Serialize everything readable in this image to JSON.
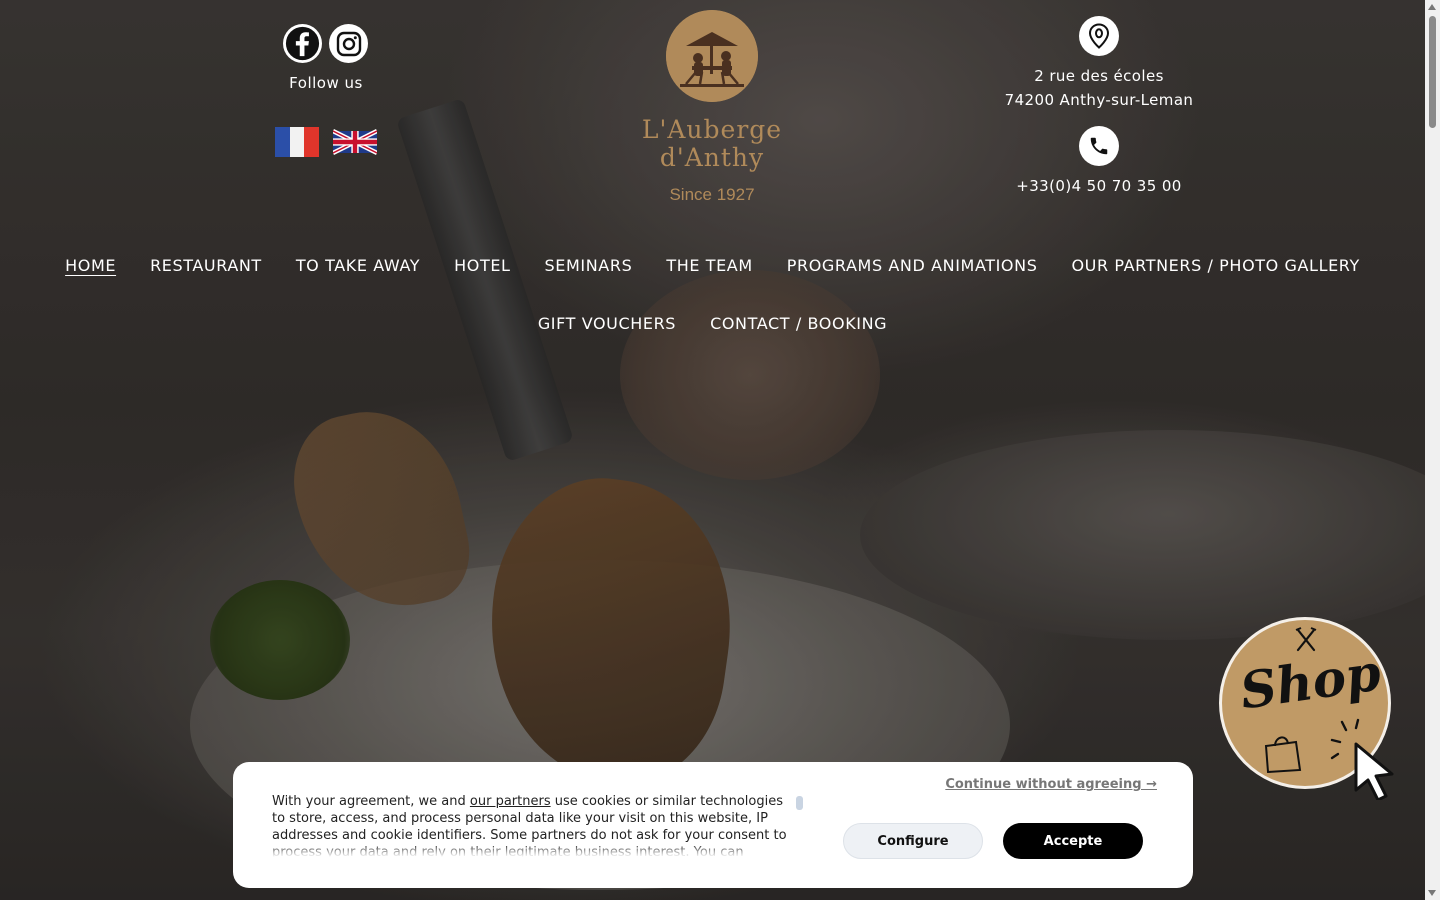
{
  "header": {
    "follow_label": "Follow us",
    "social": [
      {
        "icon": "facebook-icon"
      },
      {
        "icon": "instagram-icon"
      }
    ],
    "languages": [
      {
        "icon": "french-flag-icon"
      },
      {
        "icon": "english-flag-icon"
      }
    ],
    "logo": {
      "line1": "L'Auberge",
      "line2": "d'Anthy",
      "since": "Since 1927",
      "color": "#b08a5a"
    },
    "address": {
      "icon": "location-pin-icon",
      "line1": "2 rue des écoles",
      "line2": "74200 Anthy-sur-Leman"
    },
    "phone": {
      "icon": "phone-icon",
      "number": "+33(0)4 50 70 35 00"
    }
  },
  "nav": {
    "row1": [
      {
        "label": "HOME",
        "active": true
      },
      {
        "label": "RESTAURANT"
      },
      {
        "label": "TO TAKE AWAY"
      },
      {
        "label": "HOTEL"
      },
      {
        "label": "SEMINARS"
      },
      {
        "label": "THE TEAM"
      },
      {
        "label": "PROGRAMS AND ANIMATIONS"
      },
      {
        "label": "OUR PARTNERS / PHOTO GALLERY"
      }
    ],
    "row2": [
      {
        "label": "GIFT VOUCHERS"
      },
      {
        "label": "CONTACT / BOOKING"
      }
    ]
  },
  "shop_badge": {
    "label": "Shop",
    "color": "#c09a66",
    "icons": [
      "fork-knife-icon",
      "shopping-bag-icon",
      "cursor-icon"
    ]
  },
  "cookie_banner": {
    "continue_label": "Continue without agreeing →",
    "text_before_link": "With your agreement, we and ",
    "link_text": "our partners",
    "text_after_link": " use cookies or similar technologies to store, access, and process personal data like your visit on this website, IP addresses and cookie identifiers. Some partners do not ask for your consent to process your data and rely on their legitimate business interest. You can",
    "configure_label": "Configure",
    "accept_label": "Accepte"
  }
}
